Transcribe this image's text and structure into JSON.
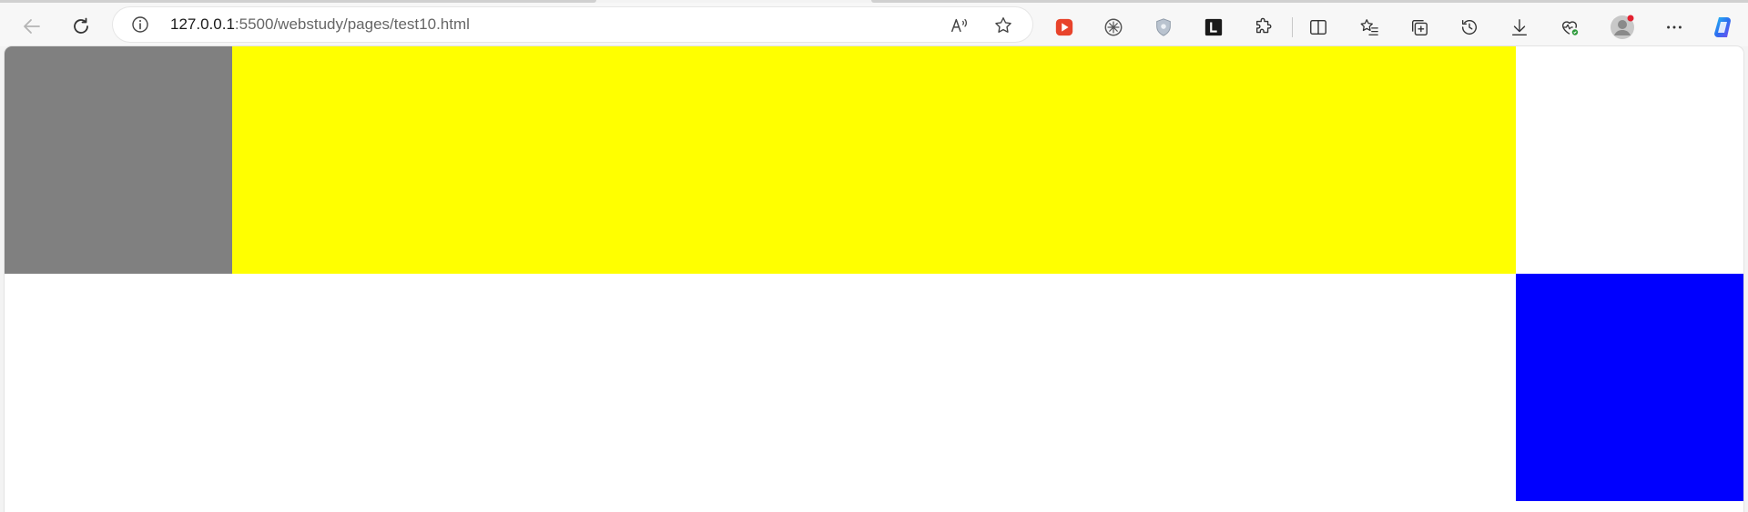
{
  "browser": {
    "url_host": "127.0.0.1",
    "url_rest": ":5500/webstudy/pages/test10.html",
    "toolbar_icons": [
      "back-icon",
      "refresh-icon",
      "site-info-icon",
      "read-aloud-icon",
      "favorite-star-icon",
      "video-extension-icon",
      "ai-extension-icon",
      "shield-extension-icon",
      "l-extension-icon",
      "extensions-puzzle-icon",
      "split-screen-icon",
      "favorites-icon",
      "collections-icon",
      "history-icon",
      "downloads-icon",
      "browser-essentials-icon",
      "profile-avatar",
      "more-options-icon",
      "copilot-icon"
    ]
  },
  "page": {
    "boxes": [
      {
        "name": "gray-box",
        "color": "#808080"
      },
      {
        "name": "yellow-box",
        "color": "#ffff00"
      },
      {
        "name": "blue-box",
        "color": "#0000ff"
      }
    ]
  }
}
